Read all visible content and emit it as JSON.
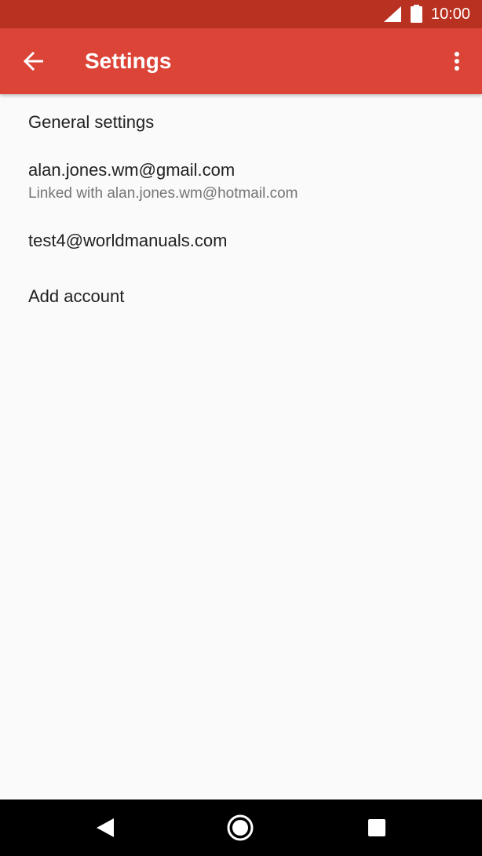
{
  "status_bar": {
    "time": "10:00",
    "icons": [
      "cell-signal-icon",
      "battery-icon"
    ]
  },
  "app_bar": {
    "title": "Settings",
    "back_icon": "arrow-back-icon",
    "overflow_icon": "more-vert-icon"
  },
  "settings_list": {
    "items": [
      {
        "primary": "General settings",
        "secondary": ""
      },
      {
        "primary": "alan.jones.wm@gmail.com",
        "secondary": "Linked with alan.jones.wm@hotmail.com"
      },
      {
        "primary": "test4@worldmanuals.com",
        "secondary": ""
      },
      {
        "primary": "Add account",
        "secondary": ""
      }
    ]
  },
  "nav_bar": {
    "icons": [
      "back-triangle-icon",
      "home-circle-icon",
      "recents-square-icon"
    ]
  },
  "colors": {
    "status_bar": "#b93221",
    "app_bar": "#db4437",
    "background": "#fafafa",
    "primary_text": "#212121",
    "secondary_text": "#757575"
  }
}
